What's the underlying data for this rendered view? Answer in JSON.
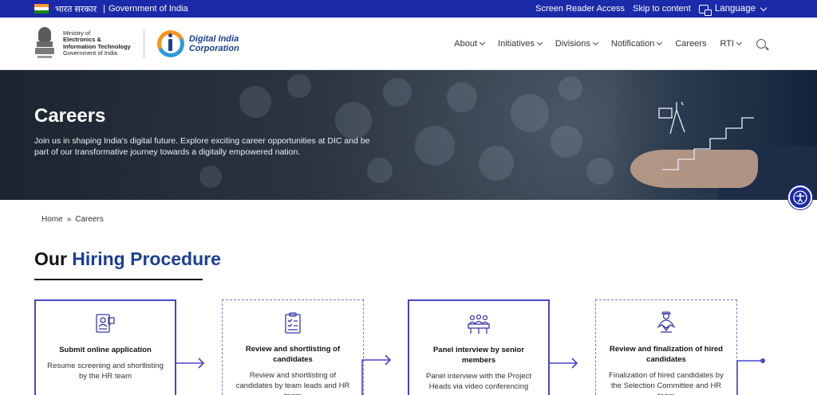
{
  "gov_bar": {
    "hindi_label": "भारत सरकार",
    "separator": "|",
    "gov_label": "Government of India",
    "screen_reader": "Screen Reader Access",
    "skip": "Skip to content",
    "language": "Language"
  },
  "header": {
    "ministry": {
      "line1": "Ministry of",
      "line2": "Electronics &",
      "line3": "Information Technology",
      "line4": "Government of India"
    },
    "dic": {
      "line1": "Digital India",
      "line2": "Corporation"
    },
    "nav": [
      {
        "label": "About",
        "has_dropdown": true
      },
      {
        "label": "Initiatives",
        "has_dropdown": true
      },
      {
        "label": "Divisions",
        "has_dropdown": true
      },
      {
        "label": "Notification",
        "has_dropdown": true
      },
      {
        "label": "Careers",
        "has_dropdown": false
      },
      {
        "label": "RTI",
        "has_dropdown": true
      }
    ]
  },
  "hero": {
    "title": "Careers",
    "subtitle": "Join us in shaping India's digital future. Explore exciting career opportunities at DIC and be part of our transformative journey towards a digitally empowered nation."
  },
  "breadcrumb": {
    "home": "Home",
    "separator": "»",
    "current": "Careers"
  },
  "section": {
    "title_plain": "Our",
    "title_accent": "Hiring Procedure"
  },
  "steps": [
    {
      "title": "Submit online application",
      "desc": "Resume screening and shortlisting by the HR team",
      "icon": "resume-icon",
      "style": "solid"
    },
    {
      "title": "Review and shortlisting of candidates",
      "desc": "Review and shortlisting of candidates by team leads and HR team",
      "icon": "clipboard-icon",
      "style": "dashed"
    },
    {
      "title": "Panel interview by senior members",
      "desc": "Panel interview with the Project Heads via video conferencing",
      "icon": "panel-interview-icon",
      "style": "solid"
    },
    {
      "title": "Review and finalization of hired candidates",
      "desc": "Finalization of hired candidates by the Selection Committee and HR team",
      "icon": "handshake-icon",
      "style": "dashed"
    }
  ],
  "colors": {
    "primary": "#1b2aa8",
    "accent": "#1c3f94",
    "step_border": "#4a46c8"
  }
}
